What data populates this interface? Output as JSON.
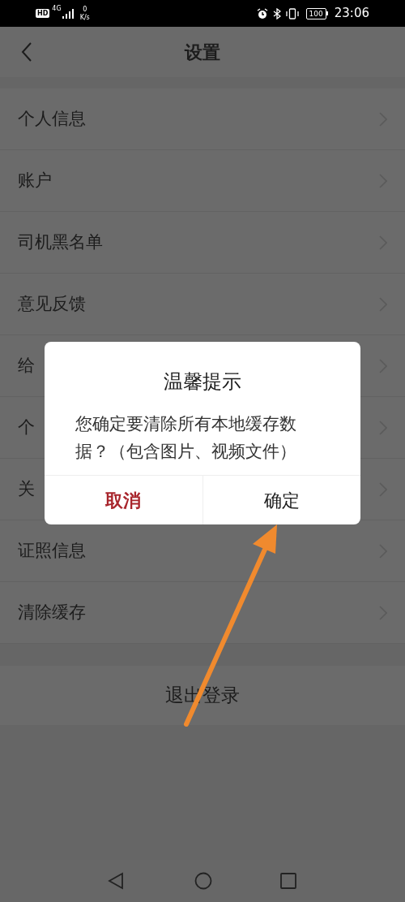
{
  "status_bar": {
    "hd": "HD",
    "network": "4G",
    "speed_value": "0",
    "speed_unit": "K/s",
    "battery": "100",
    "time": "23:06"
  },
  "header": {
    "title": "设置"
  },
  "items": [
    {
      "label": "个人信息"
    },
    {
      "label": "账户"
    },
    {
      "label": "司机黑名单"
    },
    {
      "label": "意见反馈"
    },
    {
      "label": "给"
    },
    {
      "label": "个"
    },
    {
      "label": "关"
    },
    {
      "label": "证照信息"
    },
    {
      "label": "清除缓存"
    }
  ],
  "logout": "退出登录",
  "dialog": {
    "title": "温馨提示",
    "message": "您确定要清除所有本地缓存数据？（包含图片、视频文件）",
    "buttons": [
      {
        "label": "取消",
        "kind": "cancel"
      },
      {
        "label": "确定",
        "kind": "confirm"
      }
    ]
  }
}
